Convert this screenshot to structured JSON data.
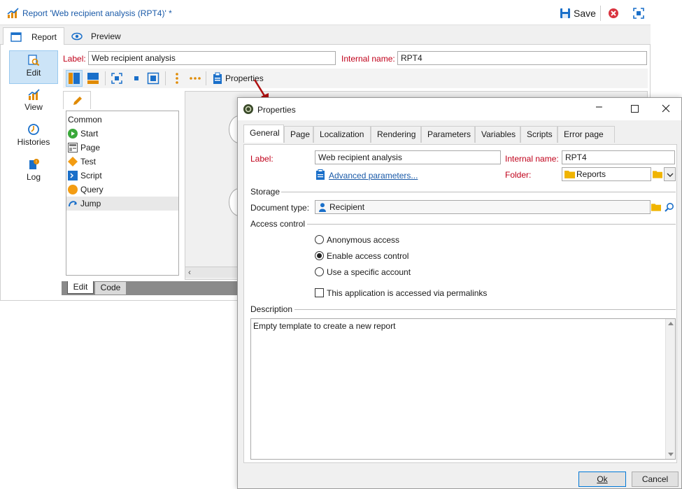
{
  "window": {
    "title": "Report 'Web recipient analysis (RPT4)' *",
    "save_label": "Save"
  },
  "tabs": [
    {
      "label": "Report"
    },
    {
      "label": "Preview"
    }
  ],
  "sidebar": {
    "items": [
      {
        "label": "Edit"
      },
      {
        "label": "View"
      },
      {
        "label": "Histories"
      },
      {
        "label": "Log"
      }
    ]
  },
  "report_form": {
    "label_caption": "Label:",
    "label_value": "Web recipient analysis",
    "internal_caption": "Internal name:",
    "internal_value": "RPT4"
  },
  "toolbar": {
    "properties_label": "Properties"
  },
  "palette": {
    "header": "Common",
    "items": [
      "Start",
      "Page",
      "Test",
      "Script",
      "Query",
      "Jump"
    ],
    "bottom_tabs": [
      "Edit",
      "Code"
    ]
  },
  "dialog": {
    "title": "Properties",
    "tabs": [
      "General",
      "Page",
      "Localization",
      "Rendering",
      "Parameters",
      "Variables",
      "Scripts",
      "Error page"
    ],
    "label_caption": "Label:",
    "label_value": "Web recipient analysis",
    "internal_caption": "Internal name:",
    "internal_value": "RPT4",
    "advanced_link": "Advanced parameters...",
    "folder_caption": "Folder:",
    "folder_value": "Reports",
    "storage_section": "Storage",
    "doctype_caption": "Document type:",
    "doctype_value": "Recipient",
    "access_section": "Access control",
    "radio_options": [
      "Anonymous access",
      "Enable access control",
      "Use a specific account"
    ],
    "radio_selected": 1,
    "permalink_label": "This application is accessed via permalinks",
    "description_section": "Description",
    "description_value": "Empty template to create a new report",
    "ok_label": "Ok",
    "cancel_label": "Cancel"
  },
  "colors": {
    "accent_blue": "#1a6fc9",
    "required_red": "#c0001a",
    "arrow_red": "#b01010",
    "sidebar_selected": "#cce4f7"
  }
}
